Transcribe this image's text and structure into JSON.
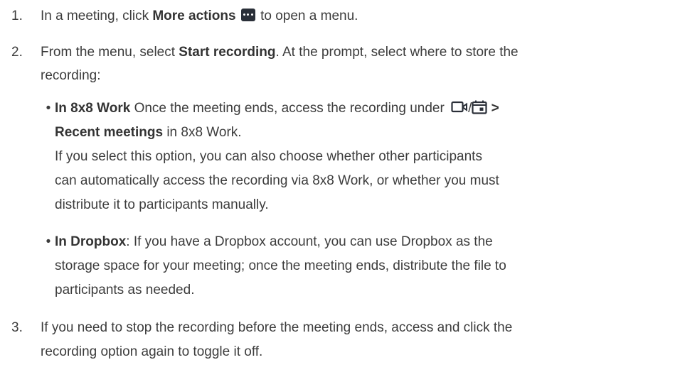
{
  "steps": [
    {
      "number": "1.",
      "prefix": "In a meeting, click ",
      "bold": "More actions",
      "icon": "more-actions-icon",
      "suffix": " to open a menu."
    },
    {
      "number": "2.",
      "prefix": "From the menu, select ",
      "bold": "Start recording",
      "suffix_line1": ". At the prompt, select where to store the",
      "line2": "recording:",
      "options": [
        {
          "bold": "In 8x8 Work",
          "line1_text": " Once the meeting ends, access the recording under ",
          "icons": [
            "video-camera-icon",
            "calendar-icon"
          ],
          "separator": "/",
          "arrow": " >",
          "line2_bold": "Recent meetings",
          "line2_text": " in 8x8 Work.",
          "para_lines": [
            "If you select this option, you can also choose whether other participants",
            "can automatically access the recording via 8x8 Work, or whether you must",
            "distribute it to participants manually."
          ]
        },
        {
          "bold": "In Dropbox",
          "lines": [
            ": If you have a Dropbox account, you can use Dropbox as the",
            "storage space for your meeting; once the meeting ends, distribute the file to",
            "participants as needed."
          ]
        }
      ]
    },
    {
      "number": "3.",
      "lines": [
        "If you need to stop the recording before the meeting ends, access and click the",
        "recording option again to toggle it off."
      ]
    }
  ],
  "colors": {
    "text": "#3c3c3c",
    "icon_bg": "#2a2f38",
    "icon_stroke": "#2a2f38"
  }
}
